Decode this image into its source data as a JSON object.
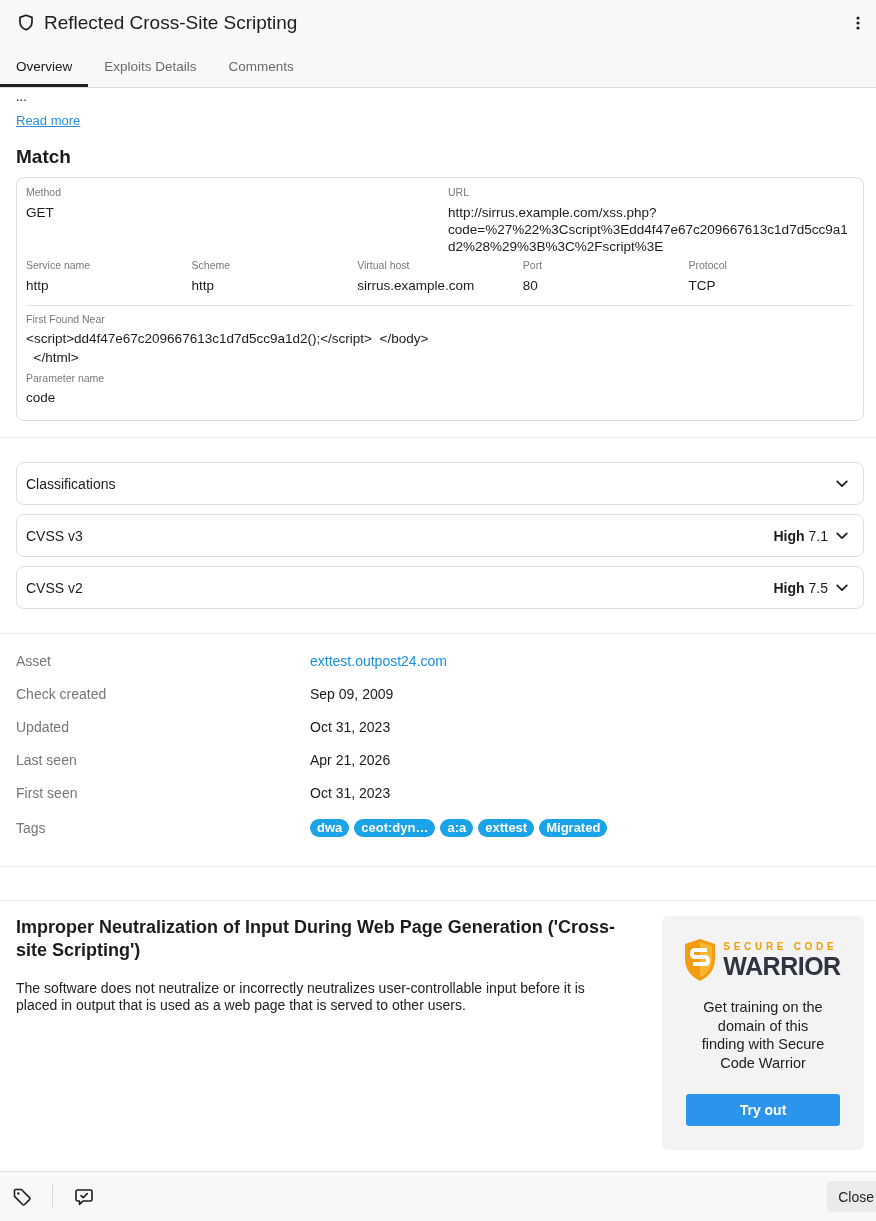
{
  "header": {
    "title": "Reflected Cross-Site Scripting"
  },
  "tabs": [
    {
      "label": "Overview",
      "selected": true
    },
    {
      "label": "Exploits Details",
      "selected": false
    },
    {
      "label": "Comments",
      "selected": false
    }
  ],
  "summary": {
    "text": "...",
    "link": "Read more"
  },
  "match": {
    "heading": "Match",
    "request": [
      {
        "label": "Method",
        "value": "GET"
      },
      {
        "label": "URL",
        "value": "http://sirrus.example.com/xss.php?code=%27%22%3Cscript%3Edd4f47e67c209667613c1d7d5cc9a1d2%28%29%3B%3C%2Fscript%3E"
      }
    ],
    "service": [
      {
        "label": "Service name",
        "value": "http"
      },
      {
        "label": "Scheme",
        "value": "http"
      },
      {
        "label": "Virtual host",
        "value": "sirrus.example.com"
      },
      {
        "label": "Port",
        "value": "80"
      },
      {
        "label": "Protocol",
        "value": "TCP"
      }
    ],
    "evidence": [
      {
        "label": "First Found Near",
        "value": "<script>dd4f47e67c209667613c1d7d5cc9a1d2();</script>  </body>\n  </html>"
      },
      {
        "label": "Parameter name",
        "value": "code"
      }
    ]
  },
  "accordions": [
    {
      "title": "Classifications",
      "expanded": false
    },
    {
      "title": "CVSS v3",
      "severity": "High",
      "score": "7.1",
      "expanded": false
    },
    {
      "title": "CVSS v2",
      "severity": "High",
      "score": "7.5",
      "expanded": false
    }
  ],
  "details": [
    {
      "kind": "link",
      "label": "Asset",
      "value": "exttest.outpost24.com"
    },
    {
      "kind": "text",
      "label": "Check created",
      "value": "Sep 09, 2009"
    },
    {
      "kind": "text",
      "label": "Updated",
      "value": "Oct 31, 2023"
    },
    {
      "kind": "text",
      "label": "Last seen",
      "value": "Apr 21, 2026"
    },
    {
      "kind": "text",
      "label": "First seen",
      "value": "Oct 31, 2023"
    },
    {
      "kind": "tags",
      "label": "Tags",
      "tags": [
        "dwa",
        "ceot:dyn…",
        "a:a",
        "exttest",
        "Migrated"
      ]
    }
  ],
  "weakness": {
    "title": "Improper Neutralization of Input During Web Page Generation ('Cross-site Scripting')",
    "description": "The software does not neutralize or incorrectly neutralizes user-controllable input before it is placed in output that is used as a web page that is served to other users."
  },
  "training": {
    "brand_top": "SECURE CODE",
    "brand_bottom": "WARRIOR",
    "text": "Get training on the domain of this finding with Secure Code Warrior",
    "button": "Try out"
  },
  "footer": {
    "button": "Close"
  }
}
